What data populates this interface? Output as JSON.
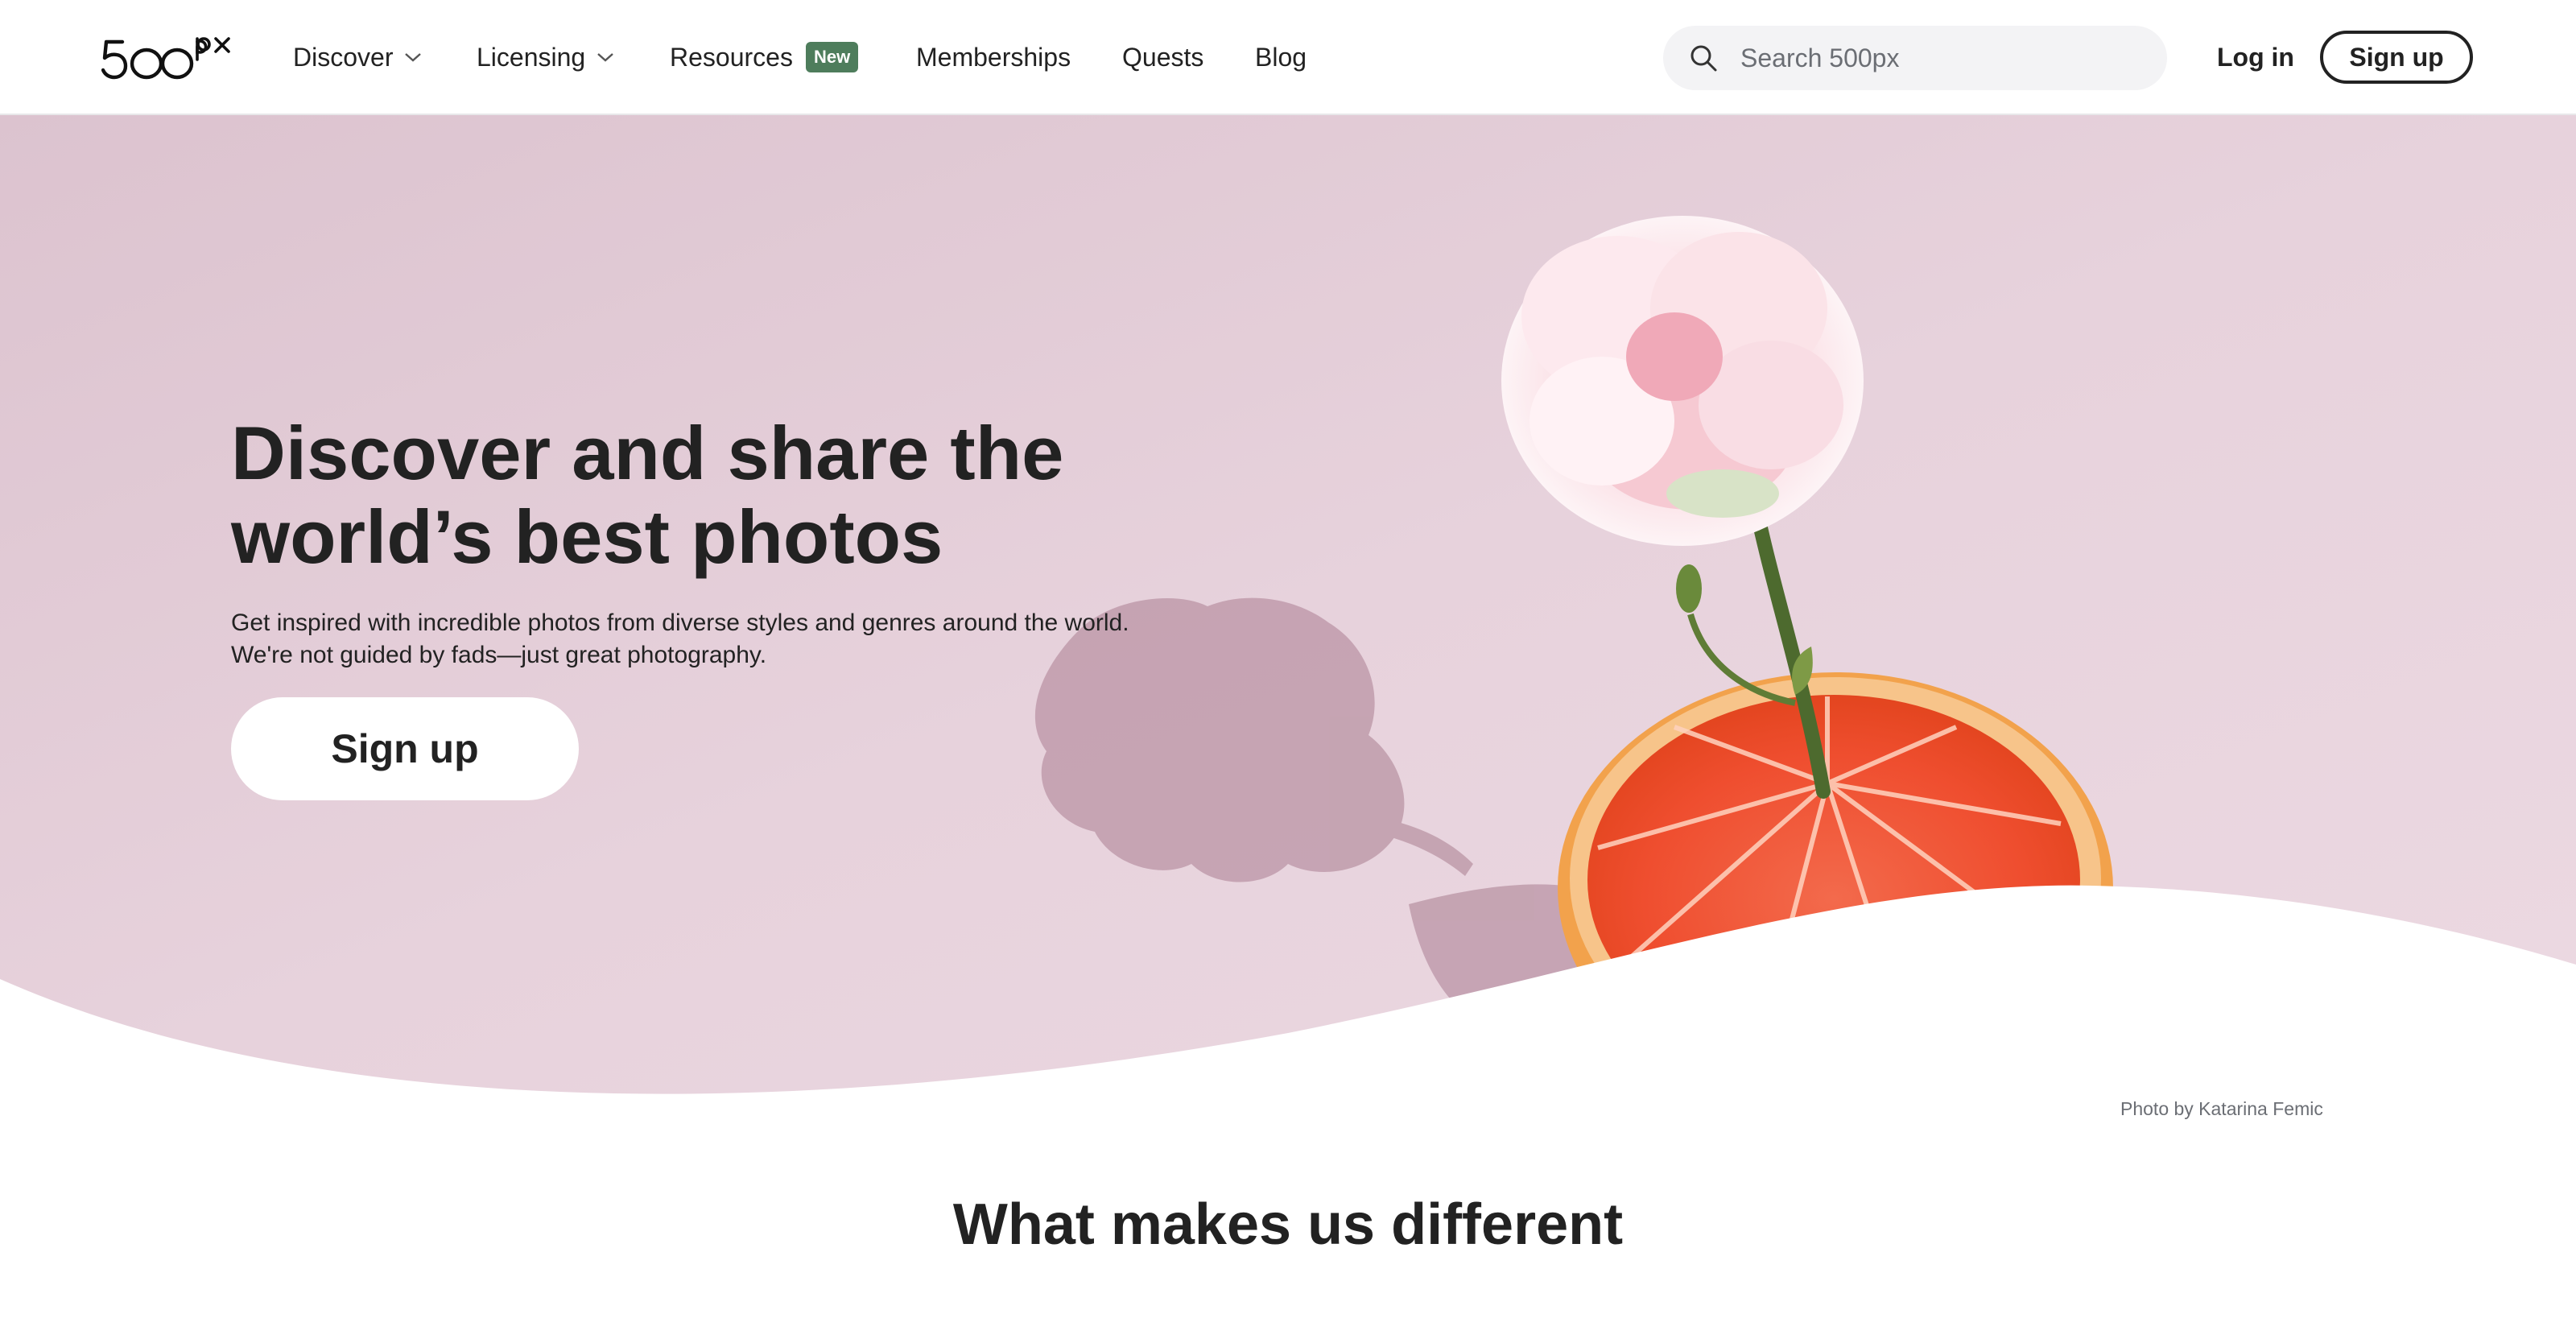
{
  "brand": {
    "logo_text": "500px"
  },
  "nav": {
    "discover": "Discover",
    "licensing": "Licensing",
    "resources": "Resources",
    "resources_badge": "New",
    "memberships": "Memberships",
    "quests": "Quests",
    "blog": "Blog"
  },
  "search": {
    "placeholder": "Search 500px",
    "value": ""
  },
  "auth": {
    "login": "Log in",
    "signup": "Sign up"
  },
  "hero": {
    "title": "Discover and share the world’s best photos",
    "subtitle": "Get inspired with incredible photos from diverse styles and genres around the world. We're not guided by fads—just great photography.",
    "cta": "Sign up",
    "photo_credit": "Photo by Katarina Femic"
  },
  "section": {
    "title": "What makes us different"
  },
  "colors": {
    "accent_badge": "#4e7d5c",
    "hero_background": "#e7d2dc",
    "text": "#222222"
  },
  "icons": [
    "logo-500px",
    "chevron-down-icon",
    "search-icon"
  ]
}
